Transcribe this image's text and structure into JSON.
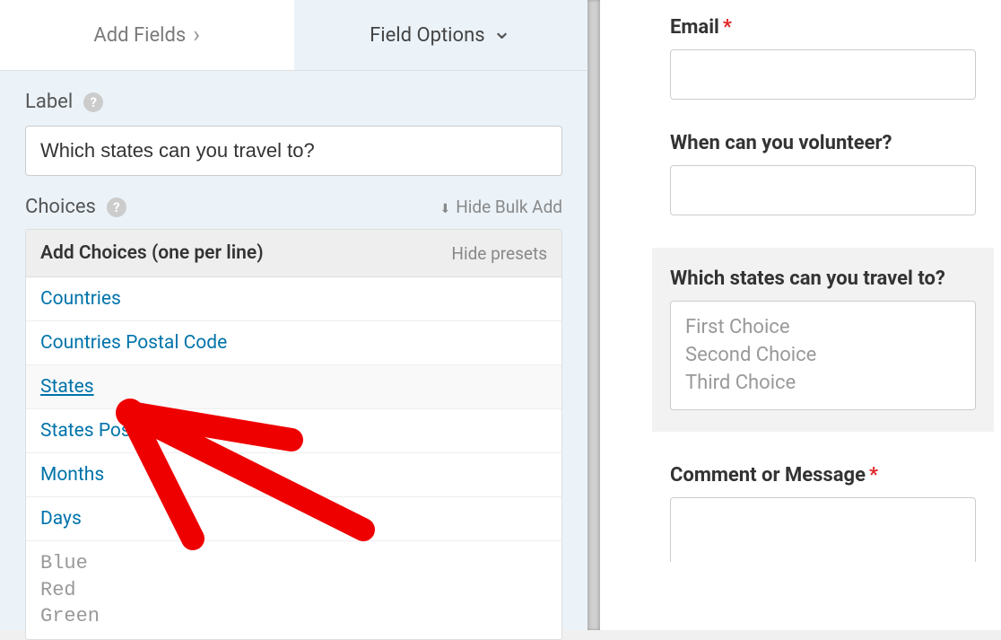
{
  "tabs": {
    "add_fields": "Add Fields",
    "field_options": "Field Options"
  },
  "label_section": {
    "title": "Label",
    "value": "Which states can you travel to?"
  },
  "choices_section": {
    "title": "Choices",
    "hide_bulk": "Hide Bulk Add",
    "header_title": "Add Choices (one per line)",
    "hide_presets": "Hide presets",
    "presets": [
      "Countries",
      "Countries Postal Code",
      "States",
      "States Postal Code",
      "Months",
      "Days"
    ],
    "typed_lines": [
      "Blue",
      "Red",
      "Green"
    ]
  },
  "preview": {
    "email": {
      "label": "Email",
      "required": true
    },
    "volunteer": {
      "label": "When can you volunteer?"
    },
    "states": {
      "label": "Which states can you travel to?",
      "choices": [
        "First Choice",
        "Second Choice",
        "Third Choice"
      ]
    },
    "comment": {
      "label": "Comment or Message",
      "required": true
    }
  }
}
